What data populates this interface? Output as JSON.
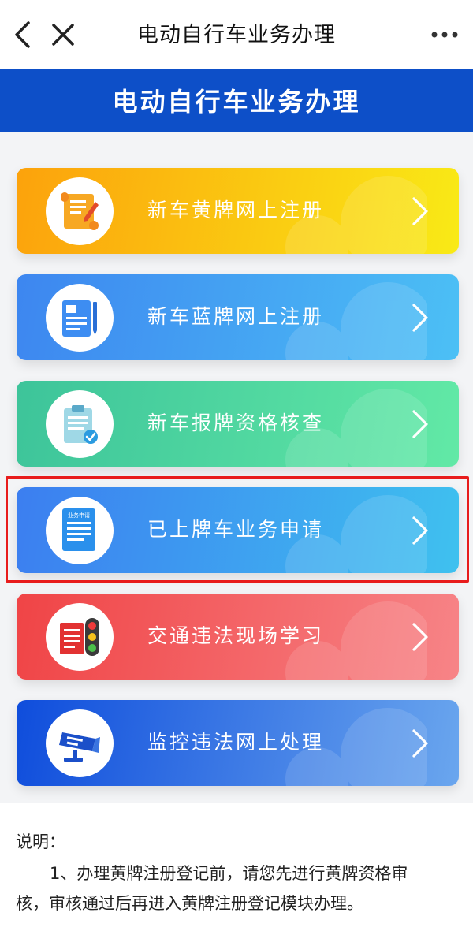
{
  "nav": {
    "title": "电动自行车业务办理",
    "back_icon": "chevron-left-icon",
    "close_icon": "close-icon",
    "more_icon": "more-icon"
  },
  "banner": {
    "title": "电动自行车业务办理",
    "color": "#0d4fc8"
  },
  "menu": {
    "items": [
      {
        "label": "新车黄牌网上注册",
        "icon": "scroll-edit-icon",
        "color_start": "#fca20c",
        "color_end": "#f9ea16"
      },
      {
        "label": "新车蓝牌网上注册",
        "icon": "document-pen-icon",
        "color_start": "#3d86f0",
        "color_end": "#4cc0f5"
      },
      {
        "label": "新车报牌资格核查",
        "icon": "clipboard-check-icon",
        "color_start": "#3dc49a",
        "color_end": "#62e9a6"
      },
      {
        "label": "已上牌车业务申请",
        "icon": "business-application-icon",
        "color_start": "#3c7ef0",
        "color_end": "#3fc1ef",
        "icon_text": "业务申请",
        "highlighted": true
      },
      {
        "label": "交通违法现场学习",
        "icon": "traffic-light-icon",
        "color_start": "#f04446",
        "color_end": "#f78487"
      },
      {
        "label": "监控违法网上处理",
        "icon": "surveillance-camera-icon",
        "color_start": "#0f4ddc",
        "color_end": "#6aa6ee"
      }
    ]
  },
  "notes": {
    "heading": "说明：",
    "line1": "1、办理黄牌注册登记前，请您先进行黄牌资格审",
    "line2": "核，审核通过后再进入黄牌注册登记模块办理。"
  }
}
